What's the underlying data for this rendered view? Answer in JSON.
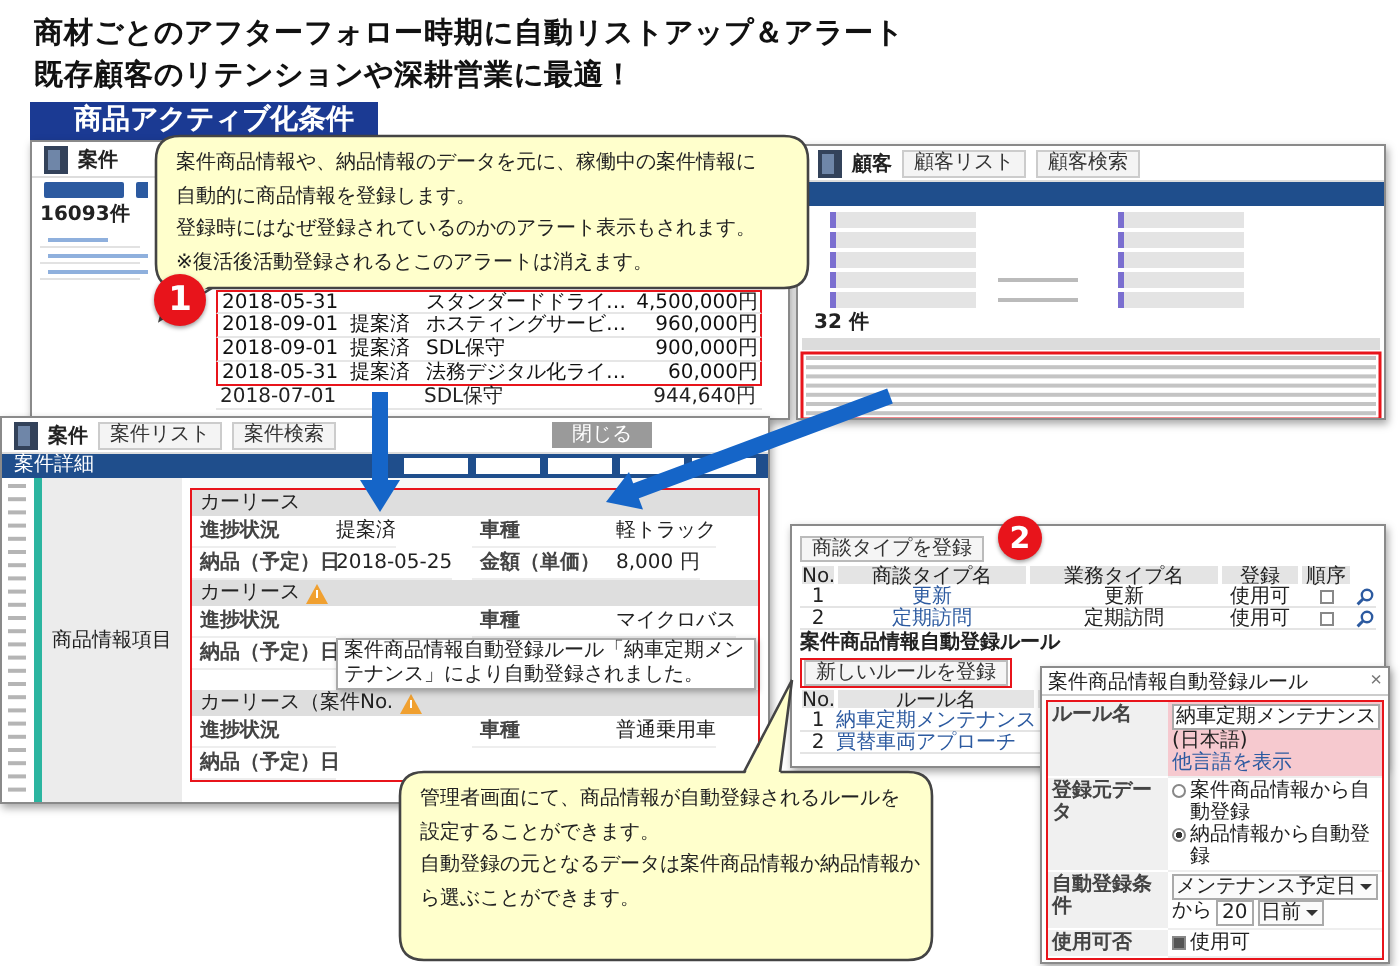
{
  "headline": [
    "商材ごとのアフターフォロー時期に自動リストアップ＆アラート",
    "既存顧客のリテンションや深耕営業に最適！"
  ],
  "section_label": "商品アクティブ化条件",
  "step_badges": [
    "1",
    "2"
  ],
  "callouts": [
    {
      "lines": [
        "案件商品情報や、納品情報のデータを元に、稼働中の案件情報に",
        "自動的に商品情報を登録します。",
        "登録時にはなぜ登録されているのかのアラート表示もされます。",
        "※復活後活動登録されるとこのアラートは消えます。"
      ]
    },
    {
      "lines": [
        "管理者画面にて、商品情報が自動登録されるルールを",
        "設定することができます。",
        "自動登録の元となるデータは案件商品情報か納品情報か",
        "ら選ぶことができます。"
      ]
    }
  ],
  "case_list": {
    "title": "案件",
    "count": "16093件",
    "rows": [
      {
        "date": "2018-05-31",
        "product": "スタンダードドライ…",
        "amount": "4,500,000円",
        "highlighted": true
      },
      {
        "date": "2018-09-01",
        "status": "提案済",
        "product": "ホスティングサービ…",
        "amount": "960,000円",
        "highlighted": true
      },
      {
        "date": "2018-09-01",
        "status": "提案済",
        "product": "SDL保守",
        "amount": "900,000円",
        "highlighted": true
      },
      {
        "date": "2018-05-31",
        "status": "提案済",
        "product": "法務デジタル化ライ…",
        "amount": "60,000円",
        "highlighted": true
      },
      {
        "date": "2018-07-01",
        "product": "SDL保守",
        "amount": "944,640円",
        "highlighted": false
      }
    ]
  },
  "customer_window": {
    "title": "顧客",
    "tabs": [
      "顧客リスト",
      "顧客検索"
    ],
    "count": "32 件"
  },
  "case_detail": {
    "title": "案件",
    "tabs": [
      "案件リスト",
      "案件検索"
    ],
    "close_button": "閉じる",
    "bar_title": "案件詳細",
    "side_label": "商品情報項目",
    "sections": [
      {
        "title": "カーリース",
        "warning": false,
        "fields": [
          {
            "label": "進捗状況",
            "value": "提案済"
          },
          {
            "label": "車種",
            "value": "軽トラック"
          },
          {
            "label": "納品（予定）日",
            "value": "2018-05-25"
          },
          {
            "label": "金額（単価）",
            "value": "8,000 円"
          }
        ]
      },
      {
        "title": "カーリース",
        "warning": true,
        "fields": [
          {
            "label": "進捗状況"
          },
          {
            "label": "車種",
            "value": "マイクロバス"
          },
          {
            "label": "納品（予定）日"
          }
        ],
        "tooltip": "案件商品情報自動登録ルール「納車定期メンテナンス」により自動登録されました。"
      },
      {
        "title": "カーリース（案件No.",
        "warning": true,
        "fields": [
          {
            "label": "進捗状況"
          },
          {
            "label": "車種",
            "value": "普通乗用車"
          },
          {
            "label": "納品（予定）日"
          }
        ]
      }
    ]
  },
  "admin": {
    "add_type_button": "商談タイプを登録",
    "type_table": {
      "columns": [
        "No.",
        "商談タイプ名",
        "業務タイプ名",
        "登録",
        "順序"
      ],
      "rows": [
        {
          "no": "1",
          "type_name": "更新",
          "business_type": "更新",
          "status": "使用可",
          "checked": false
        },
        {
          "no": "2",
          "type_name": "定期訪問",
          "business_type": "定期訪問",
          "status": "使用可",
          "checked": false
        }
      ]
    },
    "rule_heading": "案件商品情報自動登録ルール",
    "new_rule_button": "新しいルールを登録",
    "rule_table": {
      "columns": [
        "No.",
        "ルール名"
      ],
      "rows": [
        [
          "1",
          "納車定期メンテナンス"
        ],
        [
          "2",
          "買替車両アプローチ"
        ]
      ]
    }
  },
  "rule_dialog": {
    "title": "案件商品情報自動登録ルール",
    "close": "×",
    "fields": [
      {
        "kind": "text",
        "label": "ルール名",
        "value": "納車定期メンテナンス",
        "note": "(日本語)",
        "link": "他言語を表示"
      },
      {
        "kind": "radio",
        "label": "登録元データ",
        "options": [
          {
            "label": "案件商品情報から自動登録",
            "selected": false
          },
          {
            "label": "納品情報から自動登録",
            "selected": true
          }
        ]
      },
      {
        "kind": "condition",
        "label": "自動登録条件",
        "select": "メンテナンス予定日",
        "joiner": "から",
        "number": "20",
        "unit": "日前"
      },
      {
        "kind": "checkbox",
        "label": "使用可否",
        "text": "使用可",
        "checked": true
      }
    ]
  }
}
